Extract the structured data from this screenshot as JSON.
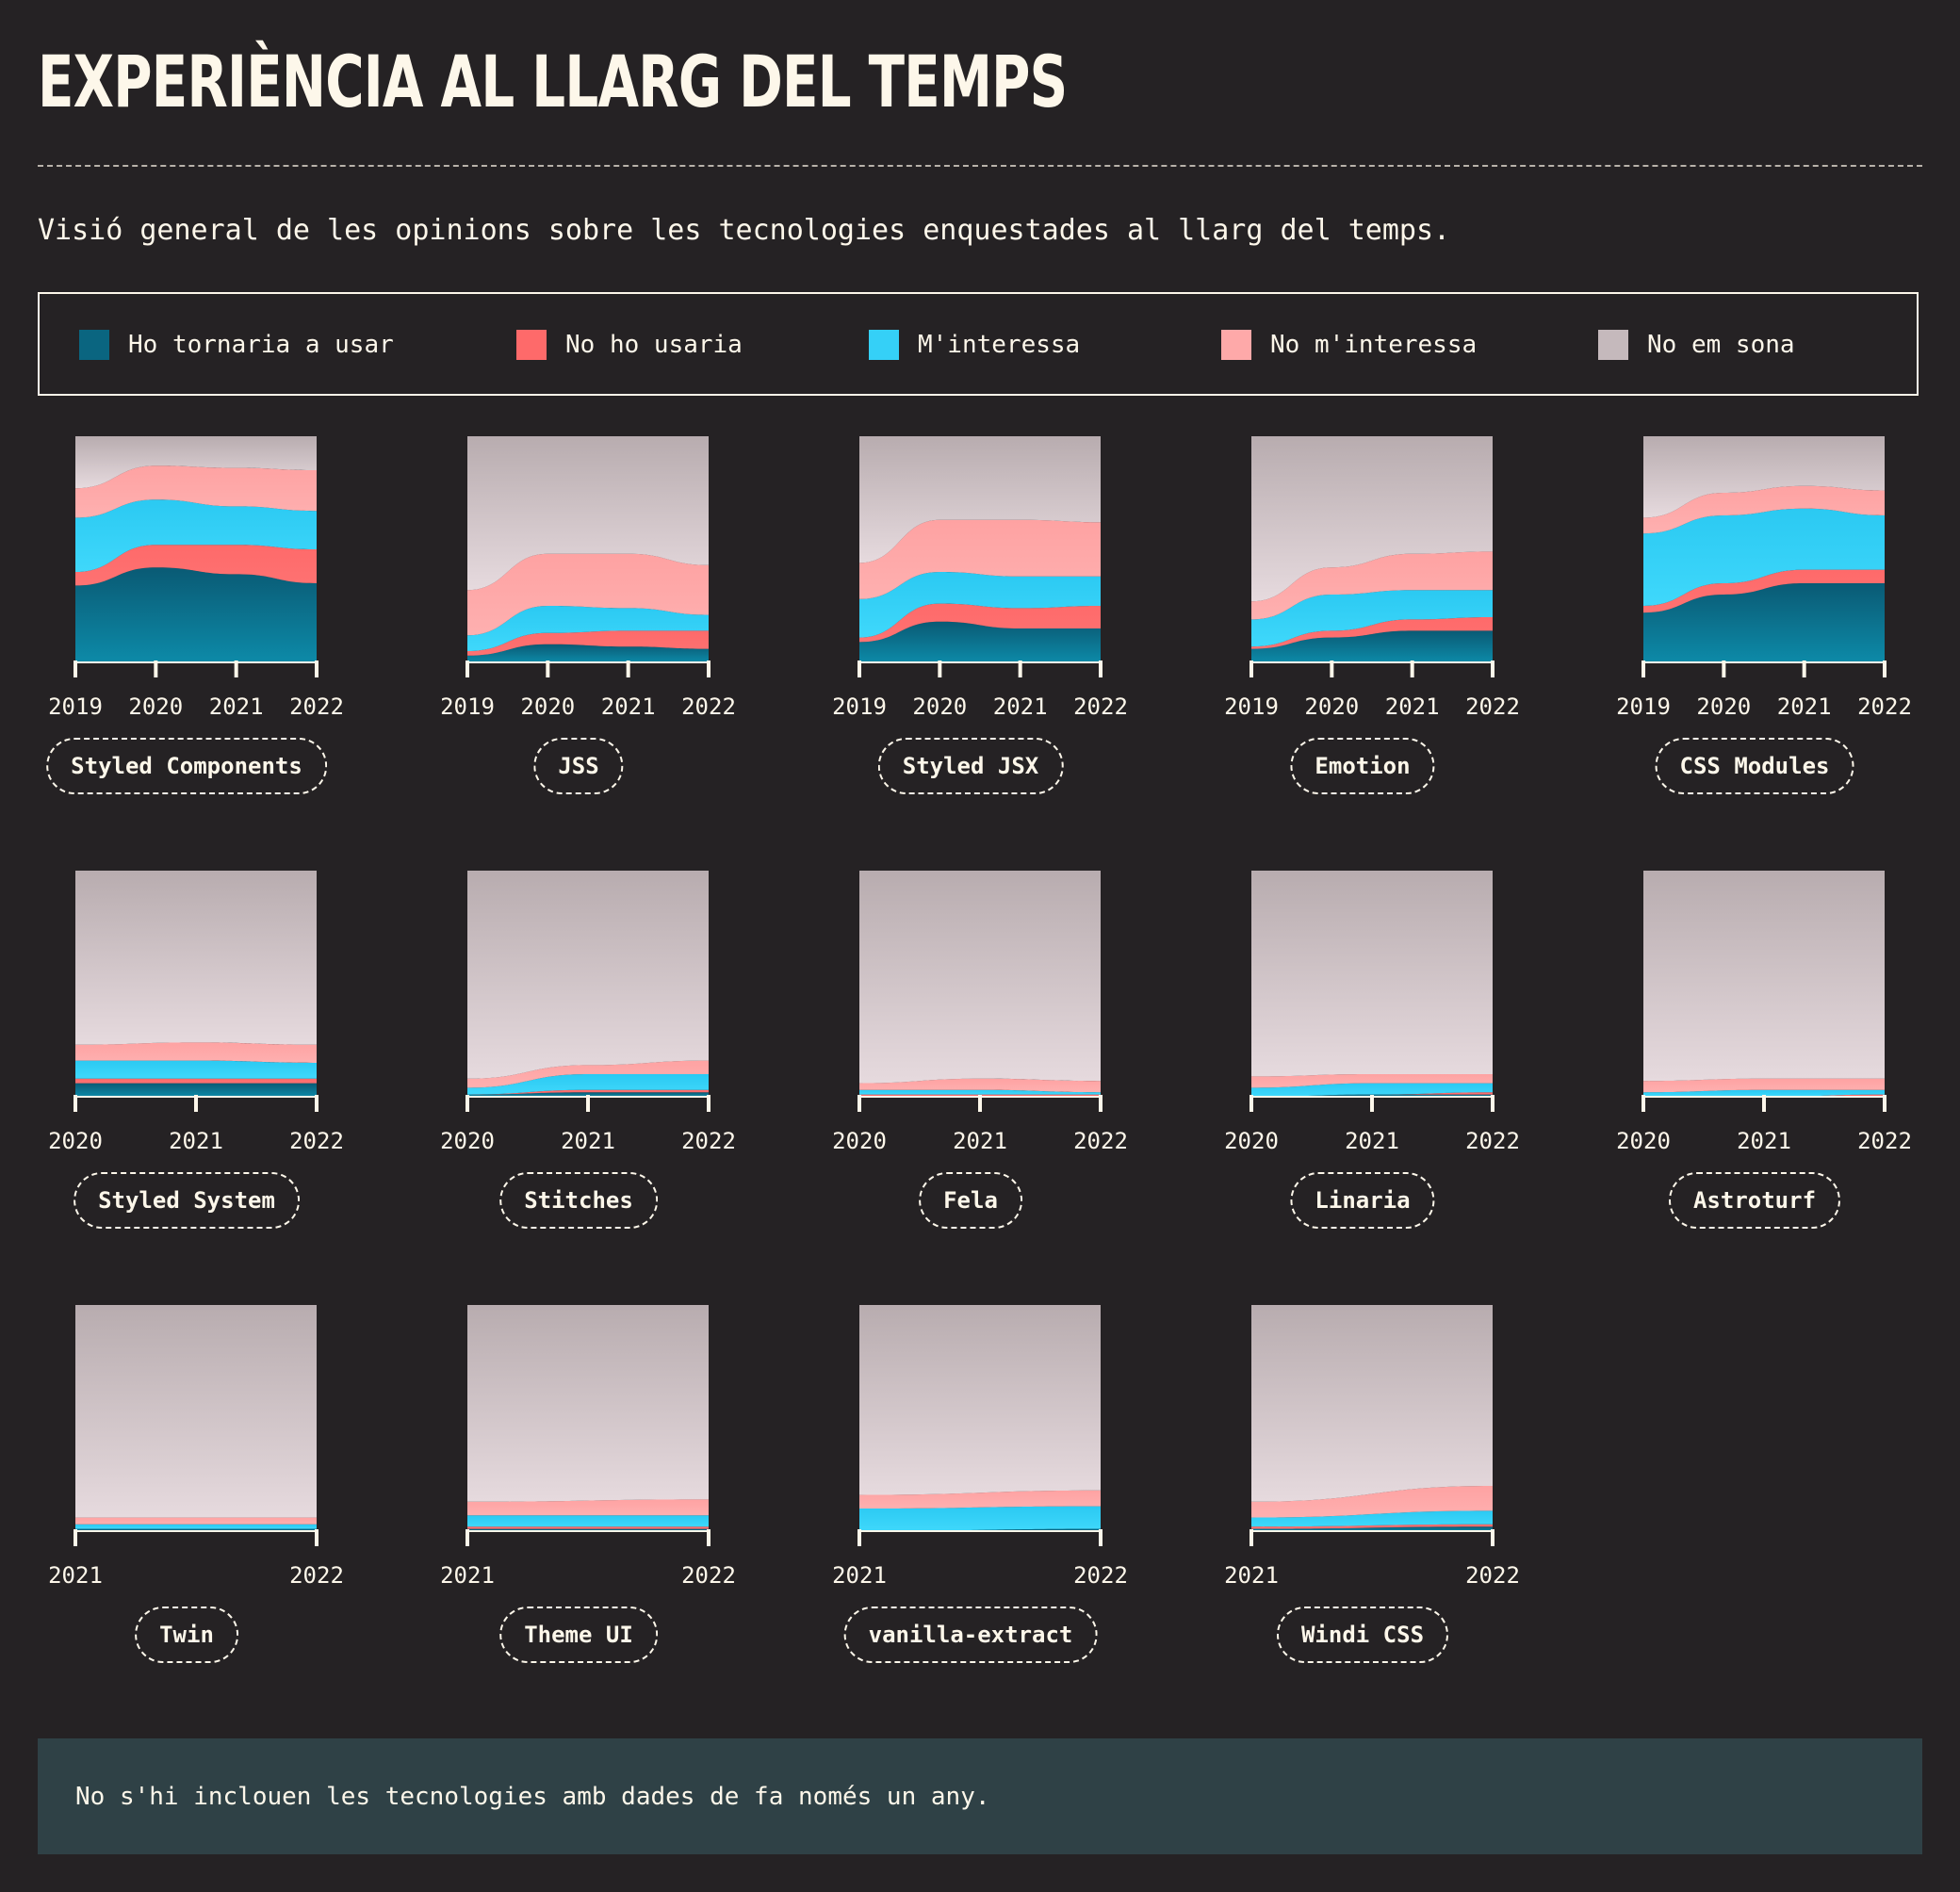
{
  "title": "EXPERIÈNCIA AL LLARG DEL TEMPS",
  "description": "Visió general de les opinions sobre les tecnologies enquestades al llarg del temps.",
  "legend": [
    {
      "label": "Ho tornaria a usar",
      "color": "#0a6580"
    },
    {
      "label": "No ho usaria",
      "color": "#fe6a6a"
    },
    {
      "label": "M'interessa",
      "color": "#35d0f7"
    },
    {
      "label": "No m'interessa",
      "color": "#fea9a9"
    },
    {
      "label": "No em sona",
      "color": "#c5b9bc"
    }
  ],
  "note": "No s'hi inclouen les tecnologies amb dades de fa només un any.",
  "chart_data": [
    {
      "type": "area",
      "name": "Styled Components",
      "x": [
        "2019",
        "2020",
        "2021",
        "2022"
      ],
      "ylim": [
        0,
        100
      ],
      "series": [
        {
          "name": "Ho tornaria a usar",
          "values": [
            34,
            42,
            39,
            35
          ]
        },
        {
          "name": "No ho usaria",
          "values": [
            6,
            10,
            13,
            15
          ]
        },
        {
          "name": "M'interessa",
          "values": [
            24,
            20,
            17,
            17
          ]
        },
        {
          "name": "No m'interessa",
          "values": [
            13,
            15,
            17,
            18
          ]
        },
        {
          "name": "No em sona",
          "values": [
            23,
            13,
            14,
            15
          ]
        }
      ]
    },
    {
      "type": "area",
      "name": "JSS",
      "x": [
        "2019",
        "2020",
        "2021",
        "2022"
      ],
      "ylim": [
        0,
        100
      ],
      "series": [
        {
          "name": "Ho tornaria a usar",
          "values": [
            3,
            8,
            7,
            6
          ]
        },
        {
          "name": "No ho usaria",
          "values": [
            2,
            5,
            7,
            8
          ]
        },
        {
          "name": "M'interessa",
          "values": [
            7,
            12,
            10,
            7
          ]
        },
        {
          "name": "No m'interessa",
          "values": [
            20,
            23,
            24,
            22
          ]
        },
        {
          "name": "No em sona",
          "values": [
            68,
            52,
            52,
            57
          ]
        }
      ]
    },
    {
      "type": "area",
      "name": "Styled JSX",
      "x": [
        "2019",
        "2020",
        "2021",
        "2022"
      ],
      "ylim": [
        0,
        100
      ],
      "series": [
        {
          "name": "Ho tornaria a usar",
          "values": [
            9,
            18,
            15,
            15
          ]
        },
        {
          "name": "No ho usaria",
          "values": [
            2,
            8,
            9,
            10
          ]
        },
        {
          "name": "M'interessa",
          "values": [
            17,
            14,
            14,
            13
          ]
        },
        {
          "name": "No m'interessa",
          "values": [
            16,
            23,
            25,
            24
          ]
        },
        {
          "name": "No em sona",
          "values": [
            56,
            37,
            37,
            38
          ]
        }
      ]
    },
    {
      "type": "area",
      "name": "Emotion",
      "x": [
        "2019",
        "2020",
        "2021",
        "2022"
      ],
      "ylim": [
        0,
        100
      ],
      "series": [
        {
          "name": "Ho tornaria a usar",
          "values": [
            6,
            11,
            14,
            14
          ]
        },
        {
          "name": "No ho usaria",
          "values": [
            1,
            3,
            5,
            6
          ]
        },
        {
          "name": "M'interessa",
          "values": [
            12,
            16,
            13,
            12
          ]
        },
        {
          "name": "No m'interessa",
          "values": [
            8,
            12,
            16,
            17
          ]
        },
        {
          "name": "No em sona",
          "values": [
            73,
            58,
            52,
            51
          ]
        }
      ]
    },
    {
      "type": "area",
      "name": "CSS Modules",
      "x": [
        "2019",
        "2020",
        "2021",
        "2022"
      ],
      "ylim": [
        0,
        100
      ],
      "series": [
        {
          "name": "Ho tornaria a usar",
          "values": [
            22,
            30,
            35,
            35
          ]
        },
        {
          "name": "No ho usaria",
          "values": [
            3,
            5,
            6,
            6
          ]
        },
        {
          "name": "M'interessa",
          "values": [
            32,
            30,
            27,
            24
          ]
        },
        {
          "name": "No m'interessa",
          "values": [
            7,
            10,
            10,
            11
          ]
        },
        {
          "name": "No em sona",
          "values": [
            36,
            25,
            22,
            24
          ]
        }
      ]
    },
    {
      "type": "area",
      "name": "Styled System",
      "x": [
        "2020",
        "2021",
        "2022"
      ],
      "ylim": [
        0,
        100
      ],
      "series": [
        {
          "name": "Ho tornaria a usar",
          "values": [
            6,
            6,
            6
          ]
        },
        {
          "name": "No ho usaria",
          "values": [
            2,
            2,
            2
          ]
        },
        {
          "name": "M'interessa",
          "values": [
            8,
            8,
            7
          ]
        },
        {
          "name": "No m'interessa",
          "values": [
            7,
            8,
            8
          ]
        },
        {
          "name": "No em sona",
          "values": [
            77,
            76,
            77
          ]
        }
      ]
    },
    {
      "type": "area",
      "name": "Stitches",
      "x": [
        "2020",
        "2021",
        "2022"
      ],
      "ylim": [
        0,
        100
      ],
      "series": [
        {
          "name": "Ho tornaria a usar",
          "values": [
            1,
            2,
            2
          ]
        },
        {
          "name": "No ho usaria",
          "values": [
            0,
            1,
            1
          ]
        },
        {
          "name": "M'interessa",
          "values": [
            3,
            7,
            7
          ]
        },
        {
          "name": "No m'interessa",
          "values": [
            4,
            4,
            6
          ]
        },
        {
          "name": "No em sona",
          "values": [
            92,
            86,
            84
          ]
        }
      ]
    },
    {
      "type": "area",
      "name": "Fela",
      "x": [
        "2020",
        "2021",
        "2022"
      ],
      "ylim": [
        0,
        100
      ],
      "series": [
        {
          "name": "Ho tornaria a usar",
          "values": [
            0,
            0,
            0
          ]
        },
        {
          "name": "No ho usaria",
          "values": [
            1,
            1,
            1
          ]
        },
        {
          "name": "M'interessa",
          "values": [
            2,
            2,
            1
          ]
        },
        {
          "name": "No m'interessa",
          "values": [
            3,
            5,
            5
          ]
        },
        {
          "name": "No em sona",
          "values": [
            94,
            92,
            93
          ]
        }
      ]
    },
    {
      "type": "area",
      "name": "Linaria",
      "x": [
        "2020",
        "2021",
        "2022"
      ],
      "ylim": [
        0,
        100
      ],
      "series": [
        {
          "name": "Ho tornaria a usar",
          "values": [
            0,
            1,
            1
          ]
        },
        {
          "name": "No ho usaria",
          "values": [
            0,
            0,
            1
          ]
        },
        {
          "name": "M'interessa",
          "values": [
            4,
            5,
            4
          ]
        },
        {
          "name": "No m'interessa",
          "values": [
            5,
            4,
            4
          ]
        },
        {
          "name": "No em sona",
          "values": [
            91,
            90,
            90
          ]
        }
      ]
    },
    {
      "type": "area",
      "name": "Astroturf",
      "x": [
        "2020",
        "2021",
        "2022"
      ],
      "ylim": [
        0,
        100
      ],
      "series": [
        {
          "name": "Ho tornaria a usar",
          "values": [
            0,
            0,
            0
          ]
        },
        {
          "name": "No ho usaria",
          "values": [
            0,
            0,
            1
          ]
        },
        {
          "name": "M'interessa",
          "values": [
            2,
            3,
            2
          ]
        },
        {
          "name": "No m'interessa",
          "values": [
            5,
            5,
            5
          ]
        },
        {
          "name": "No em sona",
          "values": [
            93,
            92,
            92
          ]
        }
      ]
    },
    {
      "type": "area",
      "name": "Twin",
      "x": [
        "2021",
        "2022"
      ],
      "ylim": [
        0,
        100
      ],
      "series": [
        {
          "name": "Ho tornaria a usar",
          "values": [
            1,
            1
          ]
        },
        {
          "name": "No ho usaria",
          "values": [
            0,
            0
          ]
        },
        {
          "name": "M'interessa",
          "values": [
            2,
            2
          ]
        },
        {
          "name": "No m'interessa",
          "values": [
            3,
            3
          ]
        },
        {
          "name": "No em sona",
          "values": [
            94,
            94
          ]
        }
      ]
    },
    {
      "type": "area",
      "name": "Theme UI",
      "x": [
        "2021",
        "2022"
      ],
      "ylim": [
        0,
        100
      ],
      "series": [
        {
          "name": "Ho tornaria a usar",
          "values": [
            1,
            1
          ]
        },
        {
          "name": "No ho usaria",
          "values": [
            1,
            1
          ]
        },
        {
          "name": "M'interessa",
          "values": [
            5,
            5
          ]
        },
        {
          "name": "No m'interessa",
          "values": [
            6,
            7
          ]
        },
        {
          "name": "No em sona",
          "values": [
            87,
            86
          ]
        }
      ]
    },
    {
      "type": "area",
      "name": "vanilla-extract",
      "x": [
        "2021",
        "2022"
      ],
      "ylim": [
        0,
        100
      ],
      "series": [
        {
          "name": "Ho tornaria a usar",
          "values": [
            0,
            1
          ]
        },
        {
          "name": "No ho usaria",
          "values": [
            0,
            0
          ]
        },
        {
          "name": "M'interessa",
          "values": [
            10,
            10
          ]
        },
        {
          "name": "No m'interessa",
          "values": [
            6,
            7
          ]
        },
        {
          "name": "No em sona",
          "values": [
            84,
            82
          ]
        }
      ]
    },
    {
      "type": "area",
      "name": "Windi CSS",
      "x": [
        "2021",
        "2022"
      ],
      "ylim": [
        0,
        100
      ],
      "series": [
        {
          "name": "Ho tornaria a usar",
          "values": [
            1,
            2
          ]
        },
        {
          "name": "No ho usaria",
          "values": [
            1,
            1
          ]
        },
        {
          "name": "M'interessa",
          "values": [
            4,
            6
          ]
        },
        {
          "name": "No m'interessa",
          "values": [
            7,
            11
          ]
        },
        {
          "name": "No em sona",
          "values": [
            87,
            80
          ]
        }
      ]
    }
  ]
}
